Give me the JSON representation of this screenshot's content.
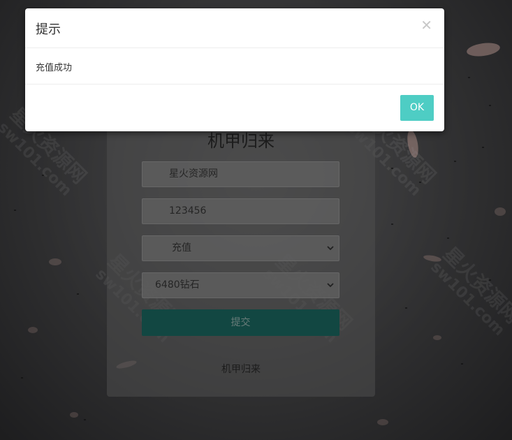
{
  "modal": {
    "title": "提示",
    "message": "充值成功",
    "close_icon": "close-icon",
    "ok_label": "OK",
    "ok_color": "#4ecdc4"
  },
  "card": {
    "title": "机甲归来",
    "username_value": "星火资源网",
    "password_value": "123456",
    "type_select_value": "充值",
    "amount_select_value": "6480钻石",
    "submit_label": "提交",
    "submit_color": "#1c6d66",
    "footer_text": "机甲归来"
  },
  "watermark": {
    "line1": "星火资源网",
    "line2": "sw101.com"
  }
}
